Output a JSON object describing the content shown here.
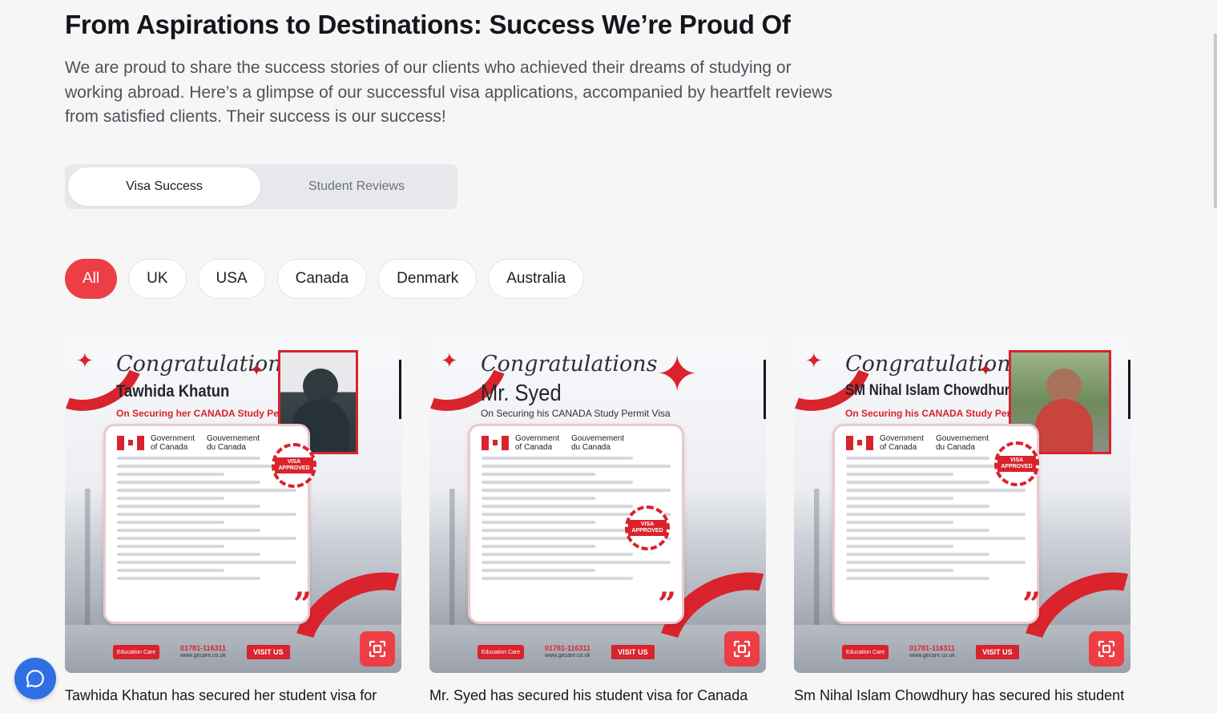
{
  "header": {
    "title": "From Aspirations to Destinations: Success We’re Proud Of",
    "description": "We are proud to share the success stories of our clients who achieved their dreams of studying or working abroad. Here’s a glimpse of our successful visa applications, accompanied by heartfelt reviews from satisfied clients. Their success is our success!"
  },
  "tabs": [
    {
      "label": "Visa Success",
      "active": true
    },
    {
      "label": "Student Reviews",
      "active": false
    }
  ],
  "filters": [
    {
      "label": "All",
      "active": true
    },
    {
      "label": "UK"
    },
    {
      "label": "USA"
    },
    {
      "label": "Canada"
    },
    {
      "label": "Denmark"
    },
    {
      "label": "Australia"
    }
  ],
  "cards": [
    {
      "congrats": "Congratulations",
      "name": "Tawhida Khatun",
      "subline": "On Securing her CANADA Study Permit Visa",
      "gov_en": "Government of Canada",
      "gov_fr": "Gouvernement du Canada",
      "stamp": "VISA APPROVED",
      "logo": "Education Care",
      "phone": "01781-116311",
      "website": "www.gecare.co.uk",
      "visit": "VISIT US",
      "caption": "Tawhida Khatun has secured her student visa for"
    },
    {
      "congrats": "Congratulations",
      "name": "Mr. Syed",
      "subline": "On Securing his CANADA Study Permit Visa",
      "gov_en": "Government of Canada",
      "gov_fr": "Gouvernement du Canada",
      "stamp": "VISA APPROVED",
      "logo": "Education Care",
      "phone": "01781-116311",
      "website": "www.gecare.co.uk",
      "visit": "VISIT US",
      "caption": "Mr. Syed has secured his student visa for Canada"
    },
    {
      "congrats": "Congratulations",
      "name": "SM Nihal Islam Chowdhury",
      "subline": "On Securing his CANADA Study Permit Visa",
      "gov_en": "Government of Canada",
      "gov_fr": "Gouvernement du Canada",
      "stamp": "VISA APPROVED",
      "logo": "Education Care",
      "phone": "01781-116311",
      "website": "www.gecare.co.uk",
      "visit": "VISIT US",
      "caption": "Sm Nihal Islam Chowdhury has secured his student"
    }
  ],
  "colors": {
    "accent": "#ee3e45",
    "chat": "#2f6fe3"
  },
  "icons": {
    "zoom": "expand-icon",
    "chat": "chat-icon"
  }
}
